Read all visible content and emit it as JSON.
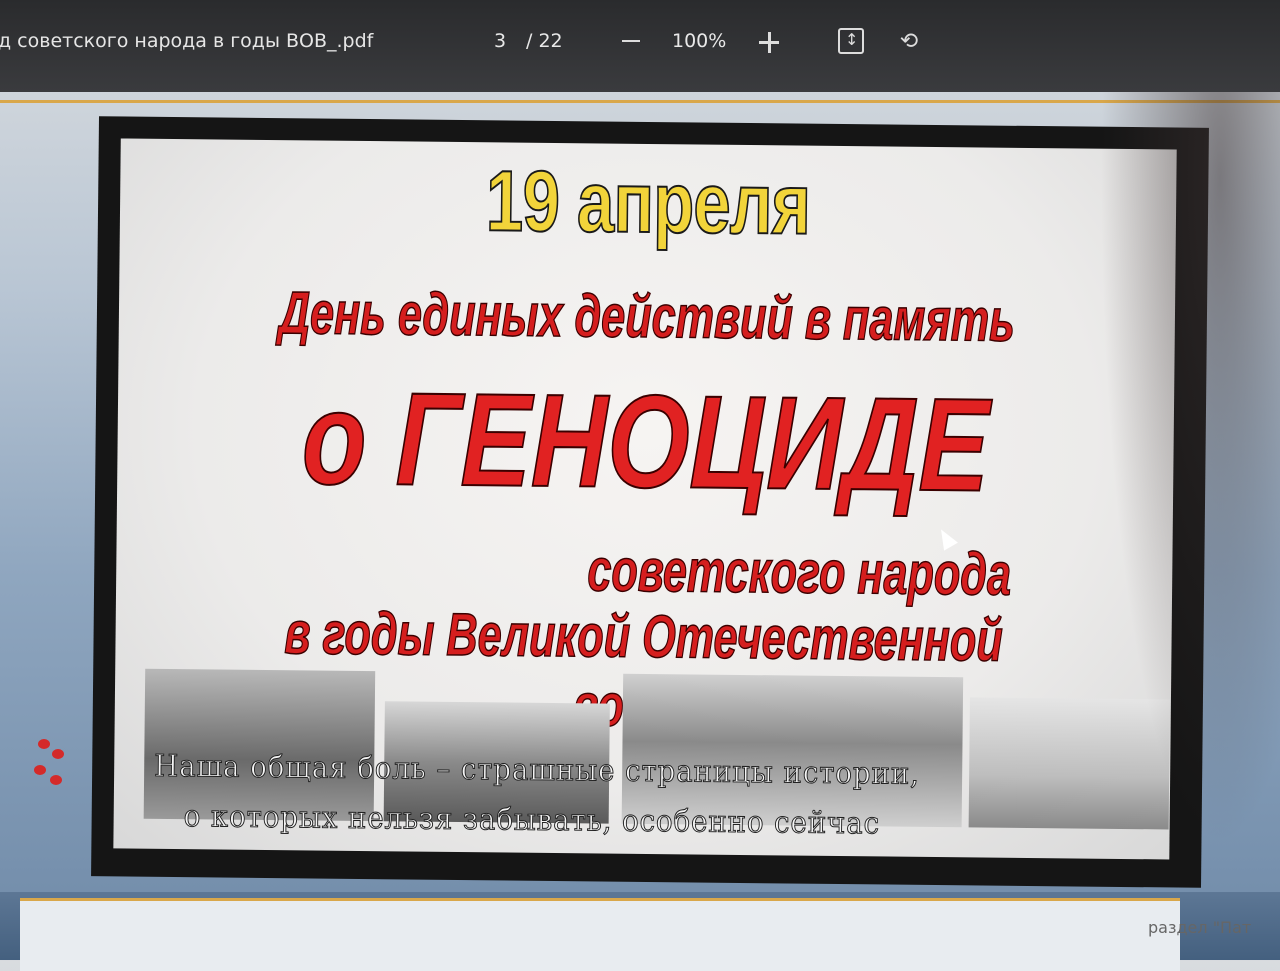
{
  "toolbar": {
    "doc_title": "д советского народа в годы ВОВ_.pdf",
    "page_current": "3",
    "page_total": "/ 22",
    "zoom": "100%",
    "rotate_glyph": "⟲"
  },
  "poster": {
    "date": "19 апреля",
    "line1": "День единых действий в память",
    "line2": "о ГЕНОЦИДЕ",
    "line3": "советского народа",
    "line4": "в годы Великой Отечественной войны",
    "caption1": "Наша общая боль – страшные страницы истории,",
    "caption2": "о которых нельзя забывать, особенно сейчас"
  },
  "footer": {
    "text": "раздел \"Пат"
  },
  "colors": {
    "toolbar_bg": "#2f3032",
    "accent_gold": "#d9a74a",
    "date_yellow": "#f2d43a",
    "headline_red": "#d51e1e"
  }
}
